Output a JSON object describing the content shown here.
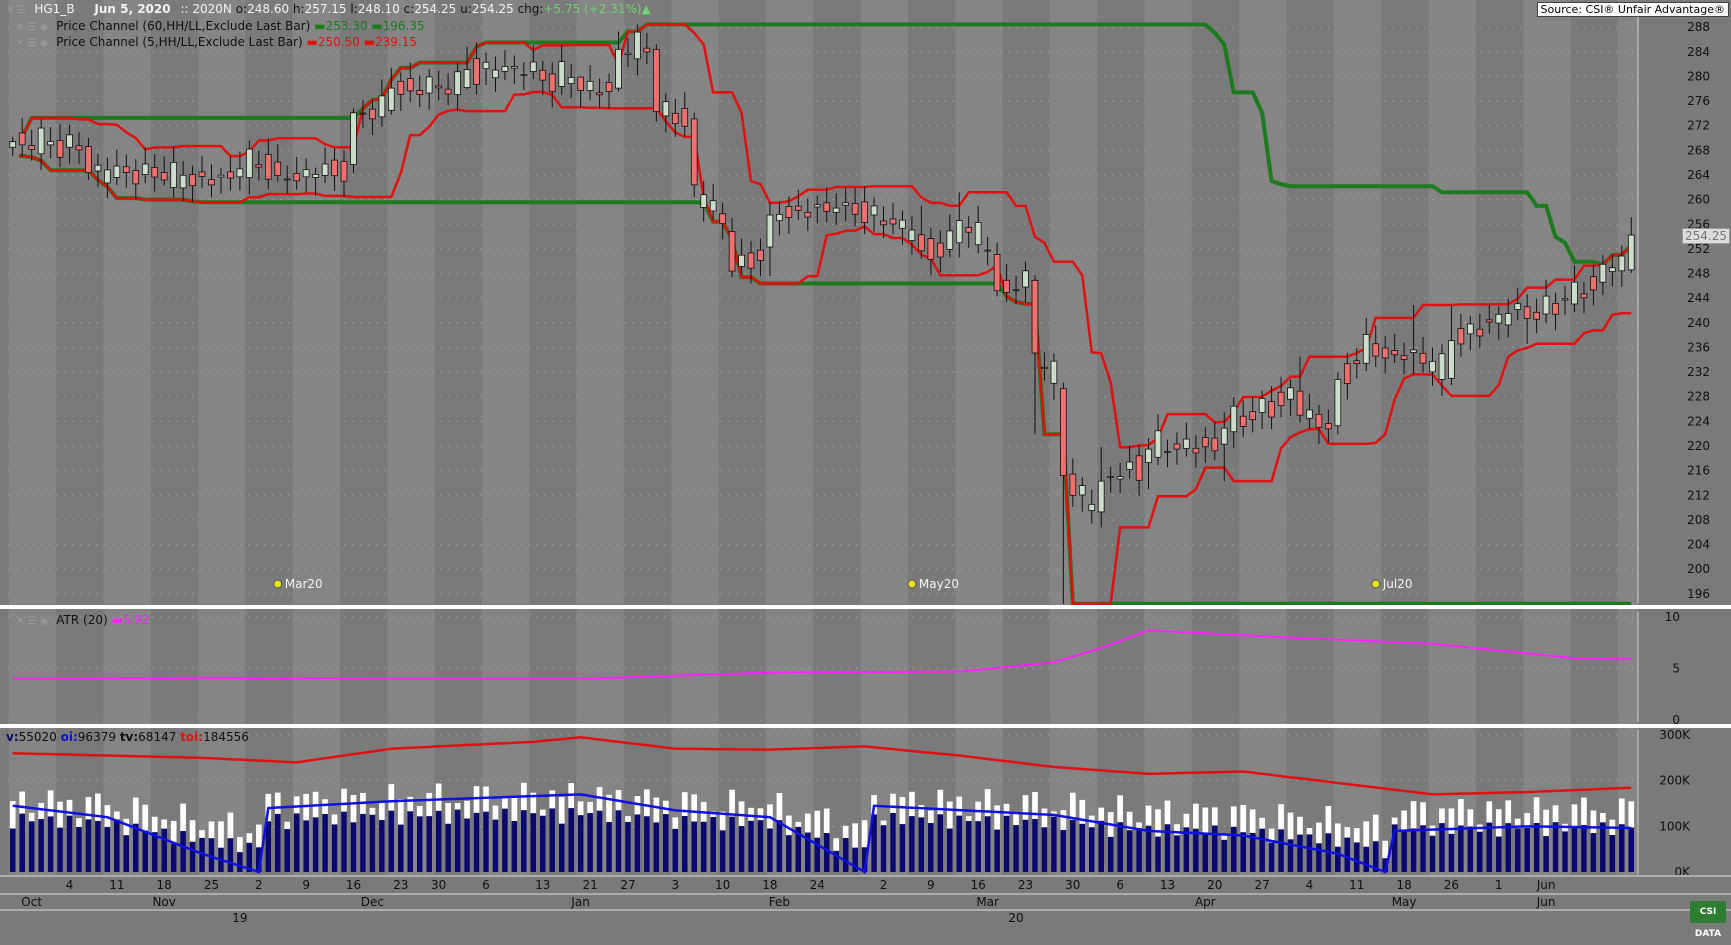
{
  "header": {
    "symbol": "HG1_B",
    "date": "Jun 5, 2020",
    "separator": "::",
    "contract": "2020N",
    "o_label": "o:",
    "o": "248.60",
    "h_label": "h:",
    "h": "257.15",
    "l_label": "l:",
    "l": "248.10",
    "c_label": "c:",
    "c": "254.25",
    "u_label": "u:",
    "u": "254.25",
    "chg_label": "chg:",
    "chg": "+5.75 (+2.31%)",
    "source": "Source: CSI® Unfair Advantage®"
  },
  "indicators": {
    "pc60": {
      "label": "Price Channel (60,HH/LL,Exclude Last Bar)",
      "upper": "253.30",
      "lower": "196.35",
      "color": "#1e7a1e"
    },
    "pc5": {
      "label": "Price Channel (5,HH/LL,Exclude Last Bar)",
      "upper": "250.50",
      "lower": "239.15",
      "color": "#e01010"
    },
    "atr": {
      "label": "ATR (20)",
      "value": "5.92",
      "color": "#ff22ff"
    },
    "volume": {
      "v_label": "v:",
      "v": "55020",
      "oi_label": "oi:",
      "oi": "96379",
      "tv_label": "tv:",
      "tv": "68147",
      "toi_label": "toi:",
      "toi": "184556"
    }
  },
  "last_price_label": "254.25",
  "logo_text": "CSI DATA",
  "colors": {
    "background": "#7a7a7a",
    "up_candle": "#c9ddc9",
    "down_candle": "#f07070",
    "volume_bar": "#0a0a6e",
    "tv_bar": "#ffffff",
    "oi_line": "#1010e0",
    "toi_line": "#e01010"
  },
  "chart_data": {
    "type": "candlestick",
    "n_bars": 172,
    "price_axis": {
      "ticks": [
        196,
        200,
        204,
        208,
        212,
        216,
        220,
        224,
        228,
        232,
        236,
        240,
        244,
        248,
        252,
        256,
        260,
        264,
        268,
        272,
        276,
        280,
        284,
        288
      ],
      "ylim": [
        195,
        289
      ]
    },
    "atr_axis": {
      "ticks": [
        "0",
        "5",
        "10"
      ],
      "ylim": [
        0,
        10
      ]
    },
    "volume_axis": {
      "ticks": [
        "0K",
        "100K",
        "200K",
        "300K"
      ],
      "ylim": [
        0,
        300000
      ]
    },
    "bars": [
      {
        "i": 0,
        "o": 268.5,
        "h": 270.2,
        "l": 267.1,
        "c": 269.4
      },
      {
        "i": 8,
        "o": 268.6,
        "h": 270.0,
        "l": 263.2,
        "c": 264.4
      },
      {
        "i": 16,
        "o": 264.4,
        "h": 267.0,
        "l": 262.3,
        "c": 263.2
      },
      {
        "i": 24,
        "o": 263.7,
        "h": 267.8,
        "l": 261.5,
        "c": 265.0
      },
      {
        "i": 28,
        "o": 266.1,
        "h": 269.0,
        "l": 262.9,
        "c": 263.9
      },
      {
        "i": 32,
        "o": 263.6,
        "h": 265.2,
        "l": 260.6,
        "c": 264.1
      },
      {
        "i": 36,
        "o": 265.7,
        "h": 274.8,
        "l": 264.3,
        "c": 274.1
      },
      {
        "i": 40,
        "o": 274.5,
        "h": 281.4,
        "l": 273.8,
        "c": 278.1
      },
      {
        "i": 48,
        "o": 278.2,
        "h": 284.8,
        "l": 277.9,
        "c": 281.1
      },
      {
        "i": 56,
        "o": 281.0,
        "h": 282.5,
        "l": 277.0,
        "c": 279.4
      },
      {
        "i": 60,
        "o": 279.9,
        "h": 280.0,
        "l": 274.9,
        "c": 277.7
      },
      {
        "i": 64,
        "o": 278.1,
        "h": 287.3,
        "l": 277.6,
        "c": 284.4
      },
      {
        "i": 68,
        "o": 284.4,
        "h": 285.2,
        "l": 272.7,
        "c": 274.3
      },
      {
        "i": 72,
        "o": 273.1,
        "h": 274.1,
        "l": 260.4,
        "c": 262.4
      },
      {
        "i": 76,
        "o": 254.8,
        "h": 257.0,
        "l": 247.4,
        "c": 248.4
      },
      {
        "i": 80,
        "o": 252.3,
        "h": 259.5,
        "l": 247.6,
        "c": 257.5
      },
      {
        "i": 88,
        "o": 259.1,
        "h": 262.0,
        "l": 256.5,
        "c": 259.5
      },
      {
        "i": 96,
        "o": 254.3,
        "h": 259.0,
        "l": 250.4,
        "c": 251.7
      },
      {
        "i": 100,
        "o": 253.0,
        "h": 261.2,
        "l": 250.6,
        "c": 256.6
      },
      {
        "i": 104,
        "o": 251.1,
        "h": 253.0,
        "l": 244.3,
        "c": 245.2
      },
      {
        "i": 108,
        "o": 246.9,
        "h": 247.7,
        "l": 221.9,
        "c": 235.1
      },
      {
        "i": 111,
        "o": 229.3,
        "h": 230.3,
        "l": 194.4,
        "c": 215.2
      },
      {
        "i": 115,
        "o": 209.3,
        "h": 219.8,
        "l": 206.8,
        "c": 214.3
      },
      {
        "i": 120,
        "o": 217.3,
        "h": 221.3,
        "l": 213.0,
        "c": 219.5
      },
      {
        "i": 128,
        "o": 220.3,
        "h": 225.5,
        "l": 214.3,
        "c": 222.9
      },
      {
        "i": 136,
        "o": 228.9,
        "h": 234.5,
        "l": 223.8,
        "c": 225.0
      },
      {
        "i": 140,
        "o": 223.3,
        "h": 232.0,
        "l": 221.9,
        "c": 230.8
      },
      {
        "i": 144,
        "o": 236.6,
        "h": 239.6,
        "l": 232.8,
        "c": 234.6
      },
      {
        "i": 148,
        "o": 235.2,
        "h": 242.9,
        "l": 231.6,
        "c": 235.6
      },
      {
        "i": 152,
        "o": 231.0,
        "h": 243.0,
        "l": 229.9,
        "c": 237.1
      },
      {
        "i": 160,
        "o": 242.6,
        "h": 244.6,
        "l": 236.6,
        "c": 240.7
      },
      {
        "i": 168,
        "o": 246.6,
        "h": 251.0,
        "l": 244.5,
        "c": 249.5
      },
      {
        "i": 171,
        "o": 248.6,
        "h": 257.15,
        "l": 248.1,
        "c": 254.25
      }
    ],
    "series": [
      {
        "name": "Price Channel (60,HH/LL,Exclude Last Bar)",
        "upper": "253.30",
        "lower": "196.35"
      },
      {
        "name": "Price Channel (5,HH/LL,Exclude Last Bar)",
        "upper": "250.50",
        "lower": "239.15"
      },
      {
        "name": "ATR (20)",
        "last": "5.92"
      },
      {
        "name": "v",
        "last": "55020"
      },
      {
        "name": "oi",
        "last": "96379"
      },
      {
        "name": "tv",
        "last": "68147"
      },
      {
        "name": "toi",
        "last": "184556"
      }
    ],
    "atr_points": [
      [
        0,
        4.0
      ],
      [
        20,
        4.1
      ],
      [
        40,
        4.0
      ],
      [
        60,
        4.0
      ],
      [
        80,
        4.6
      ],
      [
        100,
        4.7
      ],
      [
        110,
        5.6
      ],
      [
        115,
        7.0
      ],
      [
        120,
        8.7
      ],
      [
        135,
        8.0
      ],
      [
        150,
        7.4
      ],
      [
        165,
        6.0
      ],
      [
        171,
        5.92
      ]
    ],
    "toi_points": [
      [
        0,
        260000
      ],
      [
        20,
        250000
      ],
      [
        30,
        240000
      ],
      [
        40,
        270000
      ],
      [
        55,
        285000
      ],
      [
        60,
        295000
      ],
      [
        70,
        270000
      ],
      [
        80,
        268000
      ],
      [
        90,
        275000
      ],
      [
        100,
        255000
      ],
      [
        110,
        230000
      ],
      [
        120,
        215000
      ],
      [
        130,
        220000
      ],
      [
        140,
        195000
      ],
      [
        150,
        170000
      ],
      [
        160,
        175000
      ],
      [
        171,
        184556
      ]
    ],
    "oi_points": [
      [
        0,
        145000
      ],
      [
        10,
        120000
      ],
      [
        20,
        40000
      ],
      [
        26,
        0
      ],
      [
        27,
        140000
      ],
      [
        40,
        155000
      ],
      [
        60,
        170000
      ],
      [
        70,
        135000
      ],
      [
        80,
        120000
      ],
      [
        90,
        0
      ],
      [
        91,
        145000
      ],
      [
        110,
        125000
      ],
      [
        120,
        90000
      ],
      [
        130,
        80000
      ],
      [
        140,
        40000
      ],
      [
        145,
        0
      ],
      [
        146,
        90000
      ],
      [
        160,
        100000
      ],
      [
        171,
        96379
      ]
    ],
    "volume_note": "daily volume and total volume bars",
    "event_markers": [
      {
        "i": 28,
        "label": "Mar20"
      },
      {
        "i": 95,
        "label": "May20"
      },
      {
        "i": 144,
        "label": "Jul20"
      }
    ],
    "x_ticks": [
      {
        "i": 6,
        "label": "4"
      },
      {
        "i": 11,
        "label": "11"
      },
      {
        "i": 16,
        "label": "18"
      },
      {
        "i": 21,
        "label": "25"
      },
      {
        "i": 26,
        "label": "2"
      },
      {
        "i": 31,
        "label": "9"
      },
      {
        "i": 36,
        "label": "16"
      },
      {
        "i": 41,
        "label": "23"
      },
      {
        "i": 45,
        "label": "30"
      },
      {
        "i": 50,
        "label": "6"
      },
      {
        "i": 56,
        "label": "13"
      },
      {
        "i": 61,
        "label": "21"
      },
      {
        "i": 65,
        "label": "27"
      },
      {
        "i": 70,
        "label": "3"
      },
      {
        "i": 75,
        "label": "10"
      },
      {
        "i": 80,
        "label": "18"
      },
      {
        "i": 85,
        "label": "24"
      },
      {
        "i": 92,
        "label": "2"
      },
      {
        "i": 97,
        "label": "9"
      },
      {
        "i": 102,
        "label": "16"
      },
      {
        "i": 107,
        "label": "23"
      },
      {
        "i": 112,
        "label": "30"
      },
      {
        "i": 117,
        "label": "6"
      },
      {
        "i": 122,
        "label": "13"
      },
      {
        "i": 127,
        "label": "20"
      },
      {
        "i": 132,
        "label": "27"
      },
      {
        "i": 137,
        "label": "4"
      },
      {
        "i": 142,
        "label": "11"
      },
      {
        "i": 147,
        "label": "18"
      },
      {
        "i": 152,
        "label": "26"
      },
      {
        "i": 157,
        "label": "1"
      },
      {
        "i": 162,
        "label": "Jun"
      }
    ],
    "month_labels": [
      {
        "i": 2,
        "label": "Oct"
      },
      {
        "i": 16,
        "label": "Nov"
      },
      {
        "i": 38,
        "label": "Dec"
      },
      {
        "i": 60,
        "label": "Jan"
      },
      {
        "i": 81,
        "label": "Feb"
      },
      {
        "i": 103,
        "label": "Mar"
      },
      {
        "i": 126,
        "label": "Apr"
      },
      {
        "i": 147,
        "label": "May"
      },
      {
        "i": 162,
        "label": "Jun"
      }
    ],
    "year_labels": [
      {
        "i": 24,
        "label": "19"
      },
      {
        "i": 106,
        "label": "20"
      }
    ]
  }
}
